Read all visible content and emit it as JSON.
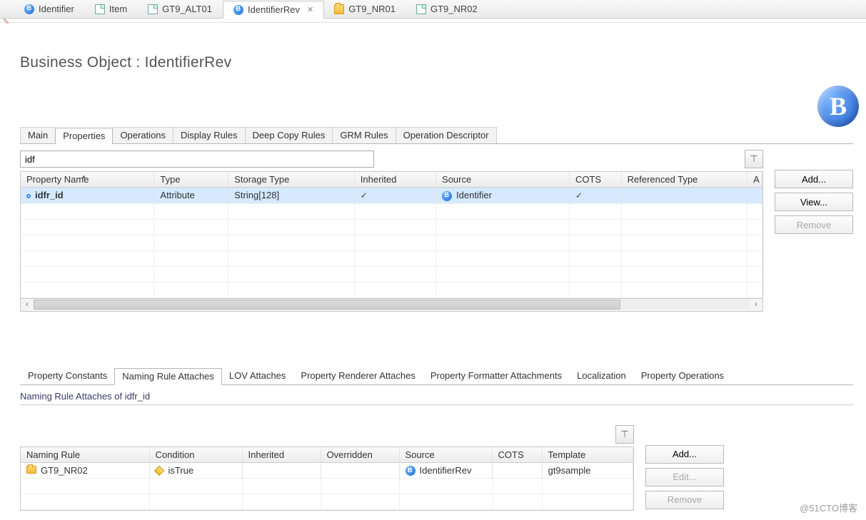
{
  "top_tabs": [
    {
      "label": "Identifier",
      "icon": "b"
    },
    {
      "label": "Item",
      "icon": "doc"
    },
    {
      "label": "GT9_ALT01",
      "icon": "doc"
    },
    {
      "label": "IdentifierRev",
      "icon": "b",
      "active": true
    },
    {
      "label": "GT9_NR01",
      "icon": "folder"
    },
    {
      "label": "GT9_NR02",
      "icon": "doc"
    }
  ],
  "page_title": "Business Object : IdentifierRev",
  "main_tabs": [
    "Main",
    "Properties",
    "Operations",
    "Display Rules",
    "Deep Copy Rules",
    "GRM Rules",
    "Operation Descriptor"
  ],
  "main_tabs_active": 1,
  "filter_value": "idf",
  "prop_table": {
    "columns": [
      "Property Name",
      "Type",
      "Storage Type",
      "Inherited",
      "Source",
      "COTS",
      "Referenced Type",
      "A"
    ],
    "rows": [
      {
        "name": "idfr_id",
        "type": "Attribute",
        "storage": "String[128]",
        "inherited": true,
        "source": "Identifier",
        "cots": true,
        "ref": ""
      }
    ]
  },
  "prop_buttons": {
    "add": "Add...",
    "view": "View...",
    "remove": "Remove"
  },
  "sub_tabs": [
    "Property Constants",
    "Naming Rule Attaches",
    "LOV Attaches",
    "Property Renderer Attaches",
    "Property Formatter Attachments",
    "Localization",
    "Property Operations"
  ],
  "sub_tabs_active": 1,
  "section_title": "Naming Rule Attaches of idfr_id",
  "rule_table": {
    "columns": [
      "Naming Rule",
      "Condition",
      "Inherited",
      "Overridden",
      "Source",
      "COTS",
      "Template"
    ],
    "rows": [
      {
        "rule": "GT9_NR02",
        "condition": "isTrue",
        "inherited": "",
        "overridden": "",
        "source": "IdentifierRev",
        "cots": "",
        "template": "gt9sample"
      }
    ]
  },
  "rule_buttons": {
    "add": "Add...",
    "edit": "Edit...",
    "remove": "Remove"
  },
  "watermark": "@51CTO博客"
}
